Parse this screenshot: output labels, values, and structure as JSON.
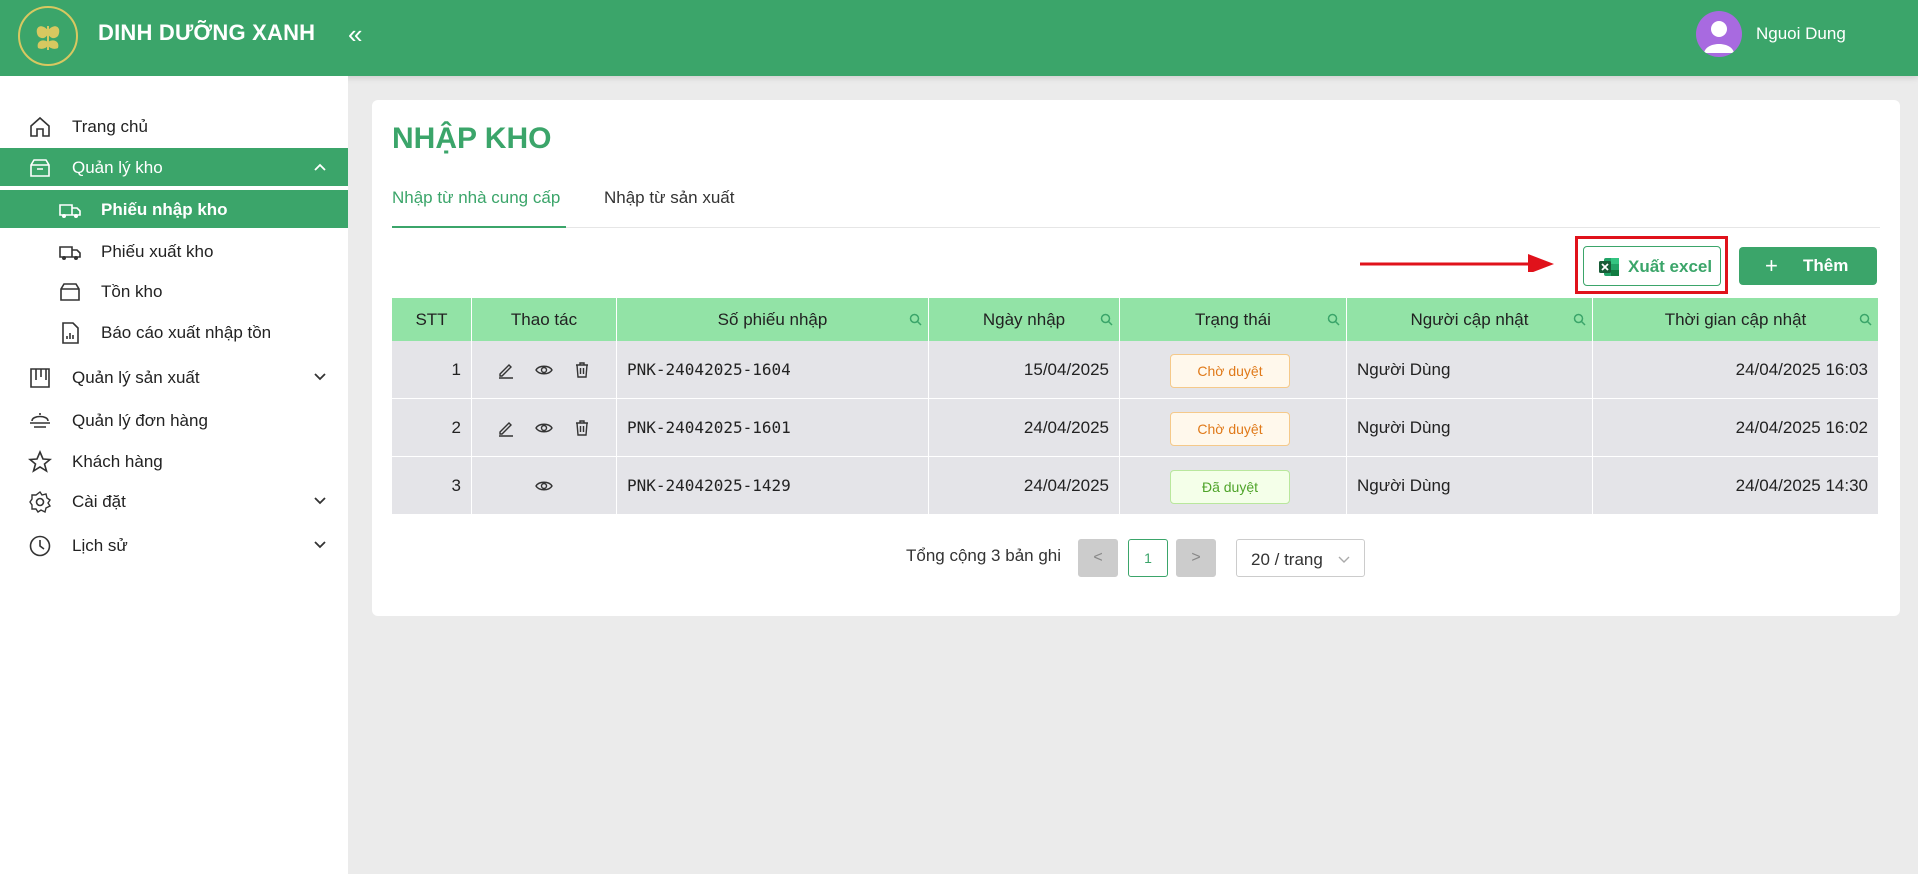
{
  "header": {
    "brand": "DINH DƯỠNG XANH",
    "collapse_glyph": "«",
    "username": "Nguoi Dung",
    "logo_icon": "leaf-logo-icon",
    "avatar_icon": "user-avatar-icon"
  },
  "sidebar": {
    "items": [
      {
        "label": "Trang chủ",
        "icon": "home-icon"
      },
      {
        "label": "Quản lý kho",
        "icon": "box-icon"
      },
      {
        "label": "Phiếu nhập kho",
        "icon": "truck-in-icon"
      },
      {
        "label": "Phiếu xuất kho",
        "icon": "truck-out-icon"
      },
      {
        "label": "Tồn kho",
        "icon": "inbox-icon"
      },
      {
        "label": "Báo cáo xuất nhập tồn",
        "icon": "report-icon"
      },
      {
        "label": "Quản lý sản xuất",
        "icon": "factory-icon"
      },
      {
        "label": "Quản lý đơn hàng",
        "icon": "order-icon"
      },
      {
        "label": "Khách hàng",
        "icon": "star-icon"
      },
      {
        "label": "Cài đặt",
        "icon": "gear-icon"
      },
      {
        "label": "Lịch sử",
        "icon": "history-icon"
      }
    ]
  },
  "main": {
    "title": "NHẬP KHO",
    "tabs": [
      {
        "label": "Nhập từ nhà cung cấp"
      },
      {
        "label": "Nhập từ sản xuất"
      }
    ],
    "buttons": {
      "export_label": "Xuất excel",
      "add_label": "Thêm",
      "add_glyph": "+"
    },
    "table": {
      "columns": [
        "STT",
        "Thao tác",
        "Số phiếu nhập",
        "Ngày nhập",
        "Trạng thái",
        "Người cập nhật",
        "Thời gian cập nhật"
      ],
      "rows": [
        {
          "stt": "1",
          "code": "PNK-24042025-1604",
          "date": "15/04/2025",
          "status": "Chờ duyệt",
          "user": "Người Dùng",
          "updated": "24/04/2025 16:03"
        },
        {
          "stt": "2",
          "code": "PNK-24042025-1601",
          "date": "24/04/2025",
          "status": "Chờ duyệt",
          "user": "Người Dùng",
          "updated": "24/04/2025 16:02"
        },
        {
          "stt": "3",
          "code": "PNK-24042025-1429",
          "date": "24/04/2025",
          "status": "Đã duyệt",
          "user": "Người Dùng",
          "updated": "24/04/2025 14:30"
        }
      ]
    },
    "pagination": {
      "total_text": "Tổng cộng 3 bản ghi",
      "prev_glyph": "<",
      "current_page": "1",
      "next_glyph": ">",
      "page_size": "20 / trang"
    }
  },
  "colors": {
    "brand_green": "#3ba56a",
    "table_header": "#92e3a6",
    "highlight_red": "#e0121b"
  }
}
